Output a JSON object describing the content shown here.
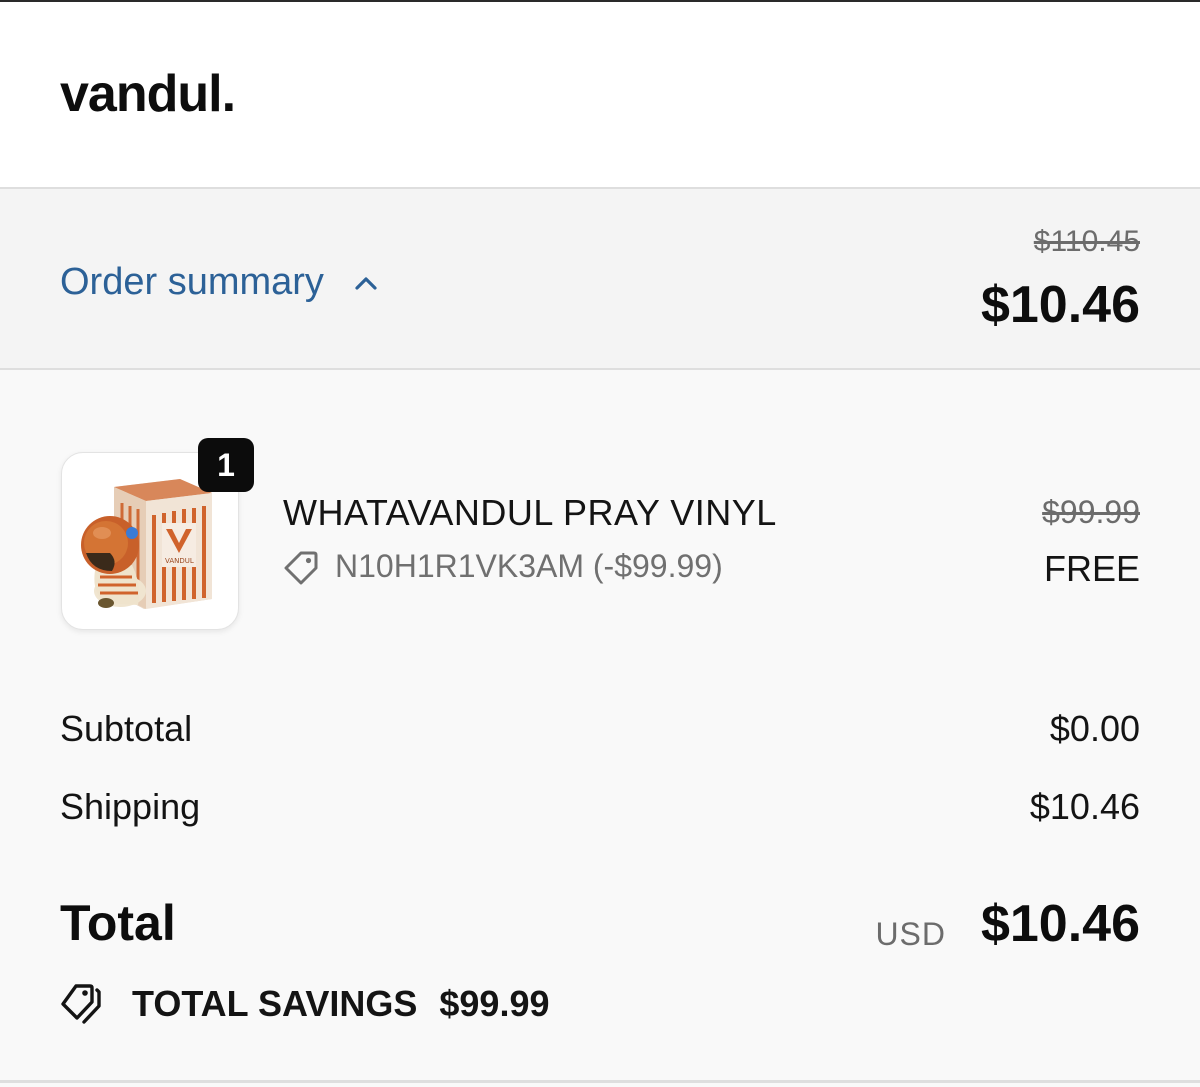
{
  "header": {
    "logo": "vandul."
  },
  "summary": {
    "toggle_label": "Order summary",
    "original_total": "$110.45",
    "total": "$10.46"
  },
  "line_items": [
    {
      "quantity": "1",
      "name": "WHATAVANDUL PRAY VINYL",
      "discount_code": "N10H1R1VK3AM (-$99.99)",
      "original_price": "$99.99",
      "price": "FREE",
      "image_brand_text": "VANDUL"
    }
  ],
  "costs": {
    "subtotal_label": "Subtotal",
    "subtotal_value": "$0.00",
    "shipping_label": "Shipping",
    "shipping_value": "$10.46"
  },
  "total": {
    "label": "Total",
    "currency": "USD",
    "amount": "$10.46"
  },
  "savings": {
    "label": "TOTAL SAVINGS",
    "amount": "$99.99"
  },
  "colors": {
    "link": "#2c6197",
    "summary_bg": "#f4f4f4",
    "details_bg": "#f9f9f9",
    "badge_bg": "#0c0c0c"
  },
  "icons": [
    "chevron-up-icon",
    "tag-icon",
    "tags-icon"
  ]
}
